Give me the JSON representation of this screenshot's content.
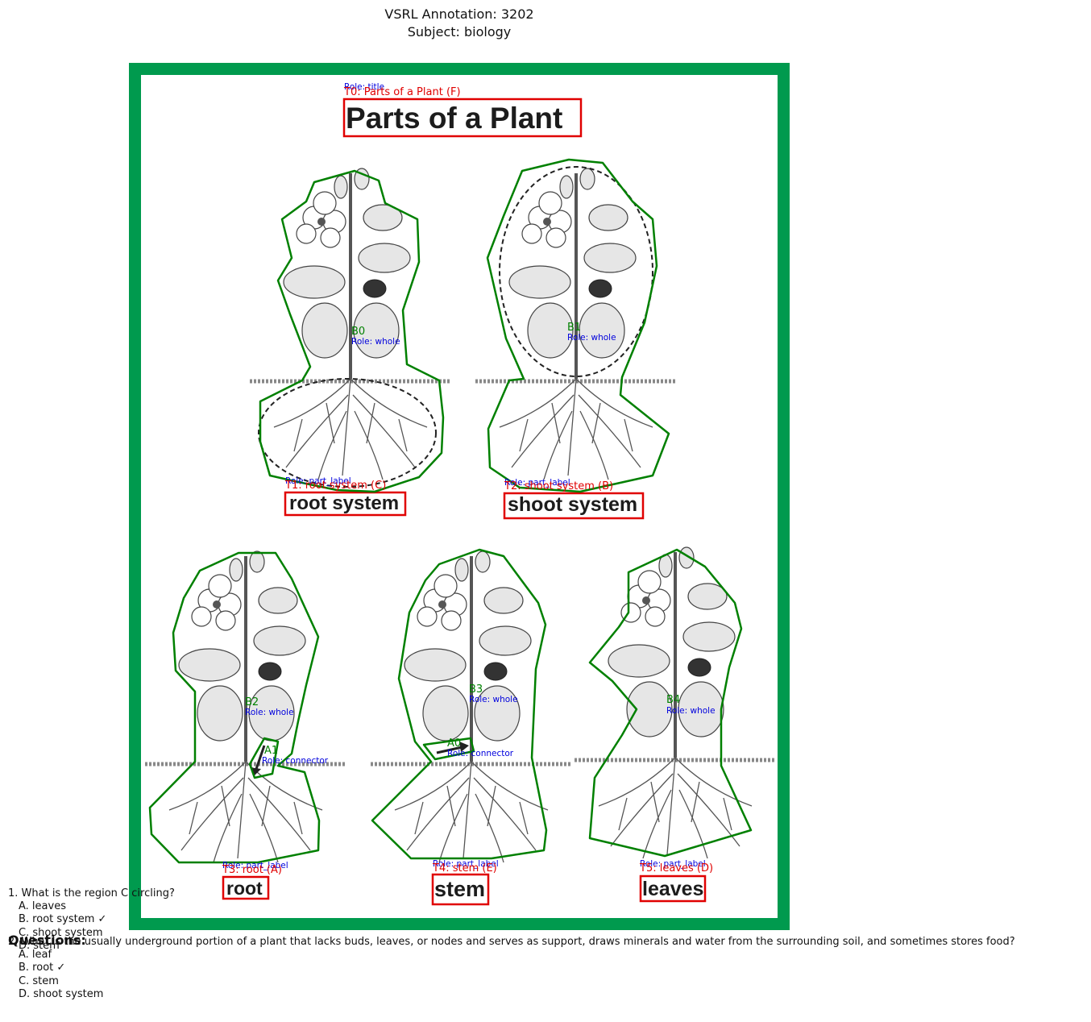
{
  "header": {
    "line1": "VSRL Annotation: 3202",
    "line2": "Subject: biology"
  },
  "diagram": {
    "title": "Parts of a Plant",
    "panel_labels": [
      "root system",
      "shoot system",
      "root",
      "stem",
      "leaves"
    ]
  },
  "annotations": {
    "text": [
      {
        "id": "T0: Parts of a Plant (F)",
        "role": "Role: title"
      },
      {
        "id": "T1: root system (C)",
        "role": "Role: part_label"
      },
      {
        "id": "T2: shoot system (B)",
        "role": "Role: part_label"
      },
      {
        "id": "T3: root (A)",
        "role": "Role: part_label"
      },
      {
        "id": "T4: stem (E)",
        "role": "Role: part_label"
      },
      {
        "id": "T5: leaves (D)",
        "role": "Role: part_label"
      }
    ],
    "blobs": [
      {
        "id": "B0",
        "role": "Role: whole"
      },
      {
        "id": "B1",
        "role": "Role: whole"
      },
      {
        "id": "B2",
        "role": "Role: whole"
      },
      {
        "id": "B3",
        "role": "Role: whole"
      },
      {
        "id": "B4",
        "role": "Role: whole"
      }
    ],
    "arrows": [
      {
        "id": "A1",
        "role": "Role: connector"
      },
      {
        "id": "A0",
        "role": "Role: connector"
      }
    ]
  },
  "colors": {
    "frame": "#009a4e",
    "annotation_box": "#e00000",
    "blob_outline": "#008000",
    "role_text": "#0000dd"
  },
  "questions": {
    "heading": "Questions:",
    "q1": {
      "text": "1. What is the region C circling?",
      "options": [
        "A. leaves",
        "B. root system ✓",
        "C. shoot system",
        "D. stem"
      ]
    },
    "q2": {
      "text": "2. What is the usually underground portion of a plant that lacks buds, leaves, or nodes and serves as support, draws minerals and water from the surrounding soil, and sometimes stores food?",
      "options": [
        "A. leaf",
        "B. root ✓",
        "C. stem",
        "D. shoot system"
      ]
    }
  }
}
